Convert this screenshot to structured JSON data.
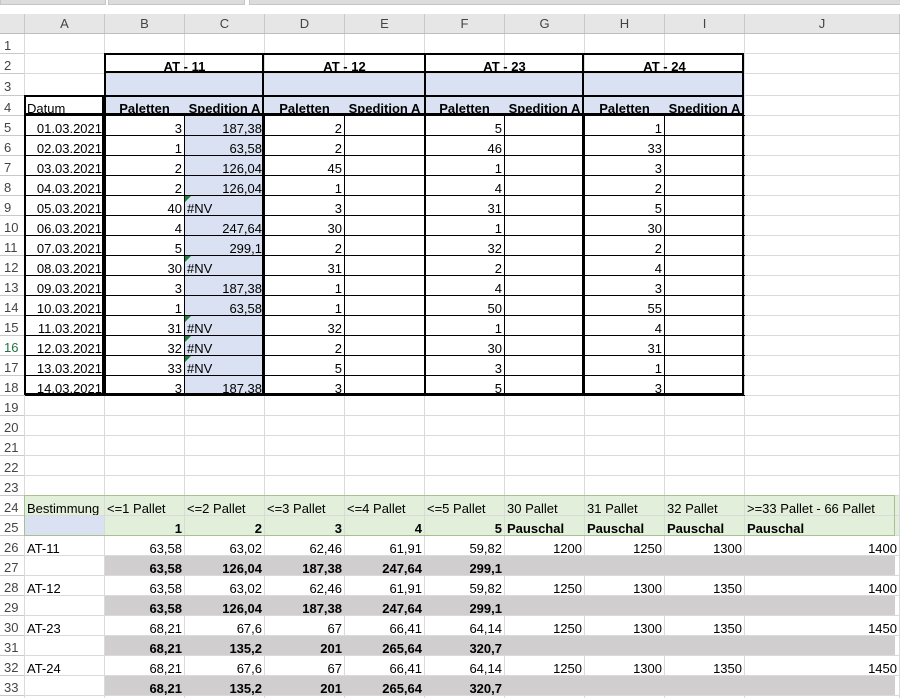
{
  "columns": [
    "A",
    "B",
    "C",
    "D",
    "E",
    "F",
    "G",
    "H",
    "I",
    "J"
  ],
  "rows": [
    "1",
    "2",
    "3",
    "4",
    "5",
    "6",
    "7",
    "8",
    "9",
    "10",
    "11",
    "12",
    "13",
    "14",
    "15",
    "16",
    "17",
    "18",
    "19",
    "20",
    "21",
    "22",
    "23",
    "24",
    "25",
    "26",
    "27",
    "28",
    "29",
    "30",
    "31",
    "32",
    "33"
  ],
  "selected_row": "16",
  "group_titles": [
    "AT - 11",
    "AT - 12",
    "AT - 23",
    "AT - 24"
  ],
  "datum_label": "Datum",
  "sub_headers": [
    "Paletten",
    "Spedition A",
    "Paletten",
    "Spedition A",
    "Paletten",
    "Spedition A",
    "Paletten",
    "Spedition A"
  ],
  "data_rows": [
    [
      "01.03.2021",
      "3",
      "187,38",
      "2",
      "",
      "5",
      "",
      "1",
      ""
    ],
    [
      "02.03.2021",
      "1",
      "63,58",
      "2",
      "",
      "46",
      "",
      "33",
      ""
    ],
    [
      "03.03.2021",
      "2",
      "126,04",
      "45",
      "",
      "1",
      "",
      "3",
      ""
    ],
    [
      "04.03.2021",
      "2",
      "126,04",
      "1",
      "",
      "4",
      "",
      "2",
      ""
    ],
    [
      "05.03.2021",
      "40",
      "#NV",
      "3",
      "",
      "31",
      "",
      "5",
      ""
    ],
    [
      "06.03.2021",
      "4",
      "247,64",
      "30",
      "",
      "1",
      "",
      "30",
      ""
    ],
    [
      "07.03.2021",
      "5",
      "299,1",
      "2",
      "",
      "32",
      "",
      "2",
      ""
    ],
    [
      "08.03.2021",
      "30",
      "#NV",
      "31",
      "",
      "2",
      "",
      "4",
      ""
    ],
    [
      "09.03.2021",
      "3",
      "187,38",
      "1",
      "",
      "4",
      "",
      "3",
      ""
    ],
    [
      "10.03.2021",
      "1",
      "63,58",
      "1",
      "",
      "50",
      "",
      "55",
      ""
    ],
    [
      "11.03.2021",
      "31",
      "#NV",
      "32",
      "",
      "1",
      "",
      "4",
      ""
    ],
    [
      "12.03.2021",
      "32",
      "#NV",
      "2",
      "",
      "30",
      "",
      "31",
      ""
    ],
    [
      "13.03.2021",
      "33",
      "#NV",
      "5",
      "",
      "3",
      "",
      "1",
      ""
    ],
    [
      "14.03.2021",
      "3",
      "187,38",
      "3",
      "",
      "5",
      "",
      "3",
      ""
    ]
  ],
  "error_rows": [
    4,
    7,
    10,
    11,
    12
  ],
  "lookup": {
    "header_row": [
      "Bestimmung",
      "<=1 Pallet",
      "<=2 Pallet",
      "<=3 Pallet",
      "<=4 Pallet",
      "<=5 Pallet",
      "30 Pallet",
      "31 Pallet",
      "32 Pallet",
      ">=33 Pallet - 66 Pallet"
    ],
    "index_row": [
      "",
      "1",
      "2",
      "3",
      "4",
      "5",
      "Pauschal",
      "Pauschal",
      "Pauschal",
      "Pauschal"
    ],
    "rows": [
      {
        "label": "AT-11",
        "values": [
          "63,58",
          "63,02",
          "62,46",
          "61,91",
          "59,82",
          "1200",
          "1250",
          "1300",
          "1400"
        ],
        "totals": [
          "63,58",
          "126,04",
          "187,38",
          "247,64",
          "299,1"
        ]
      },
      {
        "label": "AT-12",
        "values": [
          "63,58",
          "63,02",
          "62,46",
          "61,91",
          "59,82",
          "1250",
          "1300",
          "1350",
          "1400"
        ],
        "totals": [
          "63,58",
          "126,04",
          "187,38",
          "247,64",
          "299,1"
        ]
      },
      {
        "label": "AT-23",
        "values": [
          "68,21",
          "67,6",
          "67",
          "66,41",
          "64,14",
          "1250",
          "1300",
          "1350",
          "1450"
        ],
        "totals": [
          "68,21",
          "135,2",
          "201",
          "265,64",
          "320,7"
        ]
      },
      {
        "label": "AT-24",
        "values": [
          "68,21",
          "67,6",
          "67",
          "66,41",
          "64,14",
          "1250",
          "1300",
          "1350",
          "1450"
        ],
        "totals": [
          "68,21",
          "135,2",
          "201",
          "265,64",
          "320,7"
        ]
      }
    ]
  },
  "colors": {
    "header_bg": "#e6e6e6",
    "blue_fill": "#d9e1f2",
    "green_fill": "#e2efda",
    "gray_fill": "#d0cece",
    "error_marker": "#1d7d3a"
  }
}
